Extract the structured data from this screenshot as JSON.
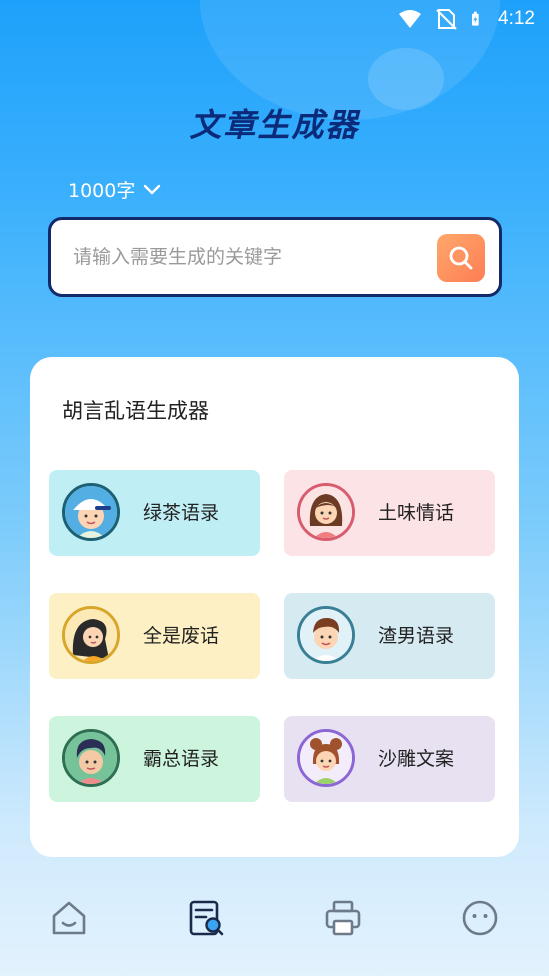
{
  "status": {
    "time": "4:12"
  },
  "app": {
    "title": "文章生成器"
  },
  "length_select": {
    "value": "1000字"
  },
  "search": {
    "placeholder": "请输入需要生成的关键字",
    "value": ""
  },
  "card": {
    "title": "胡言乱语生成器",
    "items": [
      {
        "label": "绿茶语录",
        "bg": "#c0eef5",
        "avatar_bg": "#52aee3",
        "icon": "boy-cap-avatar-icon"
      },
      {
        "label": "土味情话",
        "bg": "#fbe3e6",
        "avatar_bg": "#fde4e4",
        "icon": "girl-avatar-icon"
      },
      {
        "label": "全是废话",
        "bg": "#fdf0c4",
        "avatar_bg": "#fce9b6",
        "icon": "girl-long-hair-avatar-icon"
      },
      {
        "label": "渣男语录",
        "bg": "#d6ebf1",
        "avatar_bg": "#e0f1f7",
        "icon": "boy-avatar-icon"
      },
      {
        "label": "霸总语录",
        "bg": "#cdf5dd",
        "avatar_bg": "#76c39a",
        "icon": "man-avatar-icon"
      },
      {
        "label": "沙雕文案",
        "bg": "#e7e1f1",
        "avatar_bg": "#f3ecfb",
        "icon": "girl-bun-avatar-icon"
      }
    ]
  },
  "nav": {
    "items": [
      {
        "icon": "home-icon",
        "active": false
      },
      {
        "icon": "document-search-icon",
        "active": true
      },
      {
        "icon": "printer-icon",
        "active": false
      },
      {
        "icon": "smiley-icon",
        "active": false
      }
    ]
  },
  "colors": {
    "accent": "#0b2a7a",
    "search_button": "#fd8b5c",
    "nav_inactive": "#6d7a8a"
  }
}
